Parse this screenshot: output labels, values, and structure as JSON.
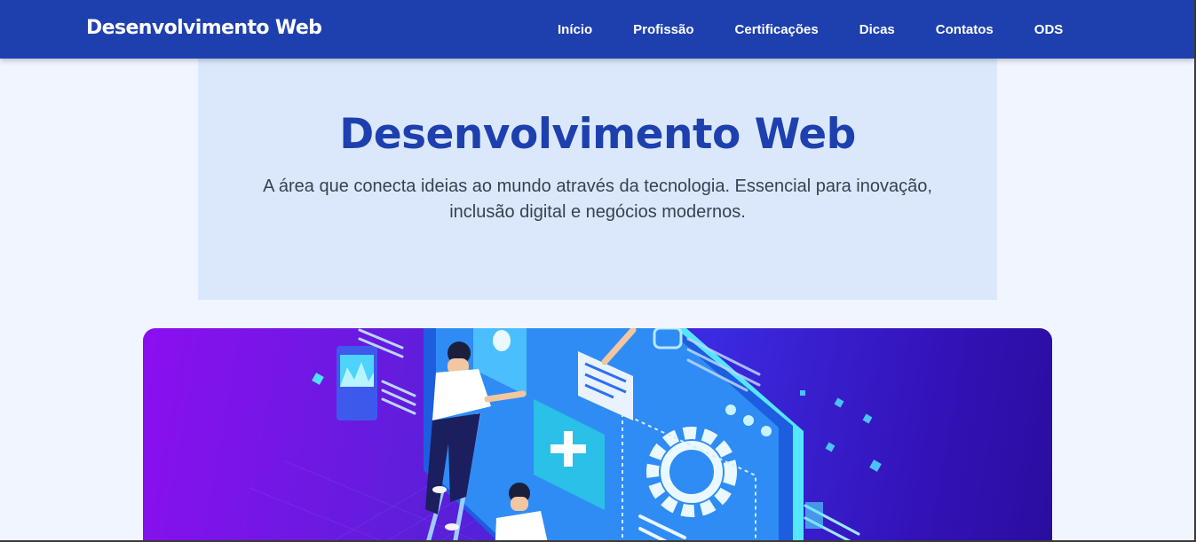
{
  "header": {
    "brand": "Desenvolvimento Web",
    "nav": [
      {
        "label": "Início"
      },
      {
        "label": "Profissão"
      },
      {
        "label": "Certificações"
      },
      {
        "label": "Dicas"
      },
      {
        "label": "Contatos"
      },
      {
        "label": "ODS"
      }
    ]
  },
  "hero": {
    "title": "Desenvolvimento Web",
    "subtitle": "A área que conecta ideias ao mundo através da tecnologia. Essencial para inovação, inclusão digital e negócios modernos."
  },
  "banner": {
    "illustration": "web-development-isometric-illustration"
  },
  "colors": {
    "header_bg": "#1e40af",
    "page_bg": "#f0f5ff",
    "hero_bg": "#dbe8fc",
    "title": "#1e40af",
    "banner_start": "#8b0ff0",
    "banner_end": "#2a0d9e"
  }
}
